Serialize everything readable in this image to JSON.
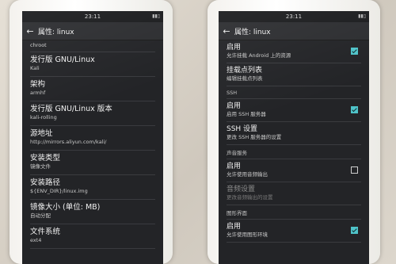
{
  "left_phone": {
    "status_time": "23:11",
    "title": "属性: linux",
    "partial_top": "chroot",
    "rows": [
      {
        "title": "发行版 GNU/Linux",
        "sub": "Kali"
      },
      {
        "title": "架构",
        "sub": "armhf"
      },
      {
        "title": "发行版 GNU/Linux 版本",
        "sub": "kali-rolling"
      },
      {
        "title": "源地址",
        "sub": "http://mirrors.aliyun.com/kali/"
      },
      {
        "title": "安装类型",
        "sub": "镜像文件"
      },
      {
        "title": "安装路径",
        "sub": "${ENV_DIR}/linux.img"
      },
      {
        "title": "镜像大小 (单位: MB)",
        "sub": "自动分配"
      },
      {
        "title": "文件系统",
        "sub": "ext4"
      }
    ]
  },
  "right_phone": {
    "status_time": "23:11",
    "title": "属性: linux",
    "rows": {
      "enable_android": {
        "title": "启用",
        "sub": "允许挂载 Android 上的资源",
        "checked": true
      },
      "mount_list": {
        "title": "挂载点列表",
        "sub": "编辑挂载点列表"
      },
      "ssh_header": "SSH",
      "ssh_enable": {
        "title": "启用",
        "sub": "启用 SSH 服务器",
        "checked": true
      },
      "ssh_settings": {
        "title": "SSH 设置",
        "sub": "更改 SSH 服务器的设置"
      },
      "audio_header": "声音服务",
      "audio_enable": {
        "title": "启用",
        "sub": "允许使用音频输出",
        "checked": false
      },
      "audio_settings": {
        "title": "音频设置",
        "sub": "更改音频输出的设置"
      },
      "gui_header": "图形界面",
      "gui_enable": {
        "title": "启用",
        "sub": "允许使用图形环境",
        "checked": true
      }
    }
  },
  "colors": {
    "screen_bg": "#232427",
    "accent_checkbox": "#4fc3c9"
  }
}
